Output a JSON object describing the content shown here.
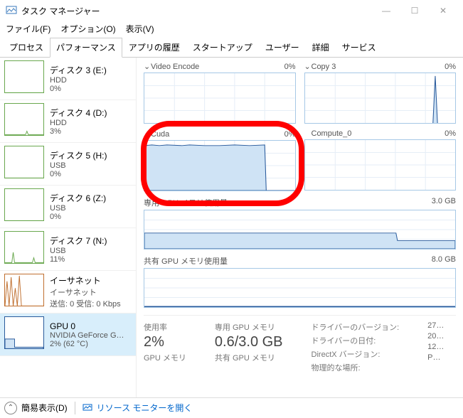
{
  "window": {
    "title": "タスク マネージャー",
    "min": "—",
    "max": "☐",
    "close": "✕"
  },
  "menu": {
    "file": "ファイル(F)",
    "option": "オプション(O)",
    "view": "表示(V)"
  },
  "tabs": [
    "プロセス",
    "パフォーマンス",
    "アプリの履歴",
    "スタートアップ",
    "ユーザー",
    "詳細",
    "サービス"
  ],
  "tabs_active_index": 1,
  "sidebar": [
    {
      "title": "ディスク 3 (E:)",
      "sub": "HDD",
      "val": "0%",
      "color": "#6aa84f"
    },
    {
      "title": "ディスク 4 (D:)",
      "sub": "HDD",
      "val": "3%",
      "color": "#6aa84f"
    },
    {
      "title": "ディスク 5 (H:)",
      "sub": "USB",
      "val": "0%",
      "color": "#6aa84f"
    },
    {
      "title": "ディスク 6 (Z:)",
      "sub": "USB",
      "val": "0%",
      "color": "#6aa84f"
    },
    {
      "title": "ディスク 7 (N:)",
      "sub": "USB",
      "val": "11%",
      "color": "#6aa84f"
    },
    {
      "title": "イーサネット",
      "sub": "イーサネット",
      "val": "送信: 0 受信: 0 Kbps",
      "color": "#c07030"
    },
    {
      "title": "GPU 0",
      "sub": "NVIDIA GeForce G…",
      "val": "2%  (62 °C)",
      "color": "#2a5b9c",
      "selected": true
    }
  ],
  "charts_top": [
    {
      "name": "Video Encode",
      "pct": "0%",
      "chev": "⌄"
    },
    {
      "name": "Copy 3",
      "pct": "0%",
      "chev": "⌄",
      "spike": true
    }
  ],
  "charts_mid": [
    {
      "name": "Cuda",
      "pct": "0%",
      "chev": "⌄",
      "filled": true
    },
    {
      "name": "Compute_0",
      "pct": "0%",
      "chev": ""
    }
  ],
  "mem1": {
    "label": "専用 GPU メモリ使用量",
    "max": "3.0 GB"
  },
  "mem2": {
    "label": "共有 GPU メモリ使用量",
    "max": "8.0 GB"
  },
  "stats": {
    "usage_label": "使用率",
    "usage_val": "2%",
    "gpu_mem_label": "GPU メモリ",
    "ded_label": "専用 GPU メモリ",
    "ded_val": "0.6/3.0 GB",
    "shared_label": "共有 GPU メモリ",
    "drv_ver_l": "ドライバーのバージョン:",
    "drv_ver_v": "27…",
    "drv_date_l": "ドライバーの日付:",
    "drv_date_v": "20…",
    "dx_l": "DirectX バージョン:",
    "dx_v": "12…",
    "loc_l": "物理的な場所:",
    "loc_v": "P…"
  },
  "status": {
    "simple": "簡易表示(D)",
    "monitor": "リソース モニターを開く"
  },
  "chart_data": [
    {
      "type": "area",
      "name": "Video Encode",
      "ylim": [
        0,
        100
      ],
      "values_pct": [
        0,
        0,
        0,
        0,
        0,
        0,
        0,
        0,
        0,
        0,
        0,
        0,
        0,
        0,
        0
      ]
    },
    {
      "type": "area",
      "name": "Copy 3",
      "ylim": [
        0,
        100
      ],
      "values_pct": [
        0,
        0,
        0,
        0,
        0,
        0,
        0,
        0,
        0,
        0,
        0,
        0,
        0,
        95,
        0
      ]
    },
    {
      "type": "area",
      "name": "Cuda",
      "ylim": [
        0,
        100
      ],
      "values_pct": [
        92,
        92,
        92,
        92,
        92,
        92,
        92,
        92,
        92,
        92,
        92,
        92,
        0,
        0,
        0
      ]
    },
    {
      "type": "area",
      "name": "Compute_0",
      "ylim": [
        0,
        100
      ],
      "values_pct": [
        0,
        0,
        0,
        0,
        0,
        0,
        0,
        0,
        0,
        0,
        0,
        0,
        0,
        0,
        0
      ]
    },
    {
      "type": "area",
      "name": "Dedicated GPU Memory",
      "ylim_gb": [
        0,
        3.0
      ],
      "values_gb": [
        1.2,
        1.2,
        1.2,
        1.2,
        1.2,
        1.2,
        1.2,
        1.2,
        1.2,
        1.2,
        1.2,
        1.2,
        0.6,
        0.6,
        0.6
      ]
    },
    {
      "type": "area",
      "name": "Shared GPU Memory",
      "ylim_gb": [
        0,
        8.0
      ],
      "values_gb": [
        0.05,
        0.05,
        0.05,
        0.05,
        0.05,
        0.05,
        0.05,
        0.05,
        0.05,
        0.05,
        0.05,
        0.05,
        0.05,
        0.05,
        0.05
      ]
    }
  ]
}
